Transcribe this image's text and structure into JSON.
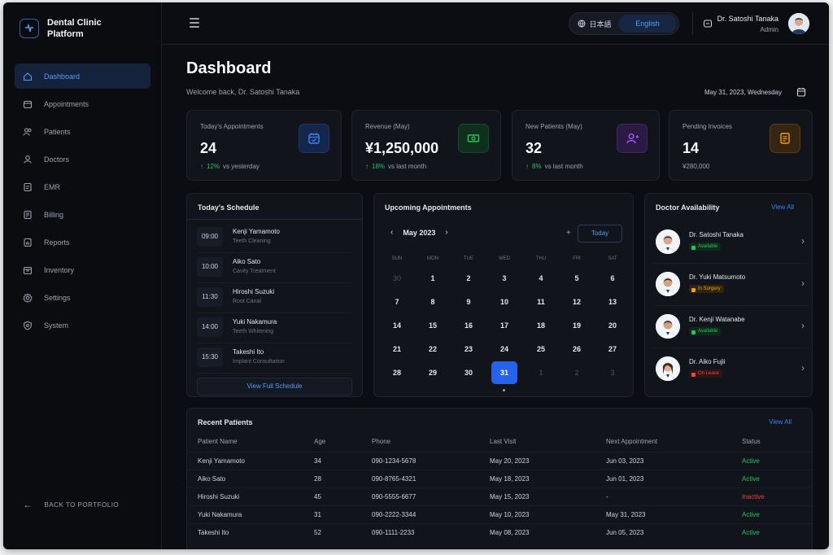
{
  "brand": {
    "name": "Dental Clinic Platform"
  },
  "sidebar": {
    "items": [
      {
        "label": "Dashboard",
        "icon": "home-icon",
        "active": true
      },
      {
        "label": "Appointments",
        "icon": "calendar-icon"
      },
      {
        "label": "Patients",
        "icon": "users-icon"
      },
      {
        "label": "Doctors",
        "icon": "user-icon"
      },
      {
        "label": "EMR",
        "icon": "file-icon"
      },
      {
        "label": "Billing",
        "icon": "billing-icon"
      },
      {
        "label": "Reports",
        "icon": "report-icon"
      },
      {
        "label": "Inventory",
        "icon": "box-icon"
      },
      {
        "label": "Settings",
        "icon": "gear-icon"
      },
      {
        "label": "System",
        "icon": "shield-icon"
      }
    ],
    "back_label": "BACK TO PORTFOLIO"
  },
  "topbar": {
    "lang_jp": "日本語",
    "lang_en": "English",
    "user_name": "Dr. Satoshi Tanaka",
    "user_role": "Admin"
  },
  "page": {
    "title": "Dashboard",
    "welcome": "Welcome back, Dr. Satoshi Tanaka",
    "date": "May 31, 2023, Wednesday"
  },
  "stats": [
    {
      "label": "Today's Appointments",
      "value": "24",
      "delta": "12%",
      "delta_text": "vs yesterday",
      "icon": "calendar-check-icon",
      "color": "#3b82f6"
    },
    {
      "label": "Revenue (May)",
      "value": "¥1,250,000",
      "delta": "18%",
      "delta_text": "vs last month",
      "icon": "money-icon",
      "color": "#22c55e"
    },
    {
      "label": "New Patients (May)",
      "value": "32",
      "delta": "8%",
      "delta_text": "vs last month",
      "icon": "user-plus-icon",
      "color": "#a855f7"
    },
    {
      "label": "Pending Invoices",
      "value": "14",
      "sub": "¥280,000",
      "icon": "invoice-icon",
      "color": "#f59e0b"
    }
  ],
  "schedule": {
    "title": "Today's Schedule",
    "button": "View Full Schedule",
    "items": [
      {
        "time": "09:00",
        "name": "Kenji Yamamoto",
        "desc": "Teeth Cleaning"
      },
      {
        "time": "10:00",
        "name": "Aiko Sato",
        "desc": "Cavity Treatment"
      },
      {
        "time": "11:30",
        "name": "Hiroshi Suzuki",
        "desc": "Root Canal"
      },
      {
        "time": "14:00",
        "name": "Yuki Nakamura",
        "desc": "Teeth Whitening"
      },
      {
        "time": "15:30",
        "name": "Takeshi Ito",
        "desc": "Implant Consultation"
      }
    ]
  },
  "calendar": {
    "title": "Upcoming Appointments",
    "month": "May 2023",
    "today_label": "Today",
    "plus": "+",
    "dow": [
      "SUN",
      "MON",
      "TUE",
      "WED",
      "THU",
      "FRI",
      "SAT"
    ],
    "weeks": [
      [
        "30",
        "1",
        "2",
        "3",
        "4",
        "5",
        "6"
      ],
      [
        "7",
        "8",
        "9",
        "10",
        "11",
        "12",
        "13"
      ],
      [
        "14",
        "15",
        "16",
        "17",
        "18",
        "19",
        "20"
      ],
      [
        "21",
        "22",
        "23",
        "24",
        "25",
        "26",
        "27"
      ],
      [
        "28",
        "29",
        "30",
        "31",
        "1",
        "2",
        "3"
      ]
    ]
  },
  "doctors": {
    "title": "Doctor Availability",
    "view_all": "View All",
    "items": [
      {
        "name": "Dr. Satoshi Tanaka",
        "status": "Available",
        "kind": "available"
      },
      {
        "name": "Dr. Yuki Matsumoto",
        "status": "In Surgery",
        "kind": "surgery"
      },
      {
        "name": "Dr. Kenji Watanabe",
        "status": "Available",
        "kind": "available"
      },
      {
        "name": "Dr. Aiko Fujii",
        "status": "On Leave",
        "kind": "leave"
      }
    ]
  },
  "patients": {
    "title": "Recent Patients",
    "view_all": "View All",
    "columns": [
      "Patient Name",
      "Age",
      "Phone",
      "Last Visit",
      "Next Appointment",
      "Status"
    ],
    "rows": [
      [
        "Kenji Yamamoto",
        "34",
        "090-1234-5678",
        "May 20, 2023",
        "Jun 03, 2023",
        "Active"
      ],
      [
        "Aiko Sato",
        "28",
        "090-8765-4321",
        "May 18, 2023",
        "Jun 01, 2023",
        "Active"
      ],
      [
        "Hiroshi Suzuki",
        "45",
        "090-5555-6677",
        "May 15, 2023",
        "-",
        "Inactive"
      ],
      [
        "Yuki Nakamura",
        "31",
        "090-2222-3344",
        "May 10, 2023",
        "May 31, 2023",
        "Active"
      ],
      [
        "Takeshi Ito",
        "52",
        "090-1111-2233",
        "May 08, 2023",
        "Jun 05, 2023",
        "Active"
      ]
    ]
  }
}
